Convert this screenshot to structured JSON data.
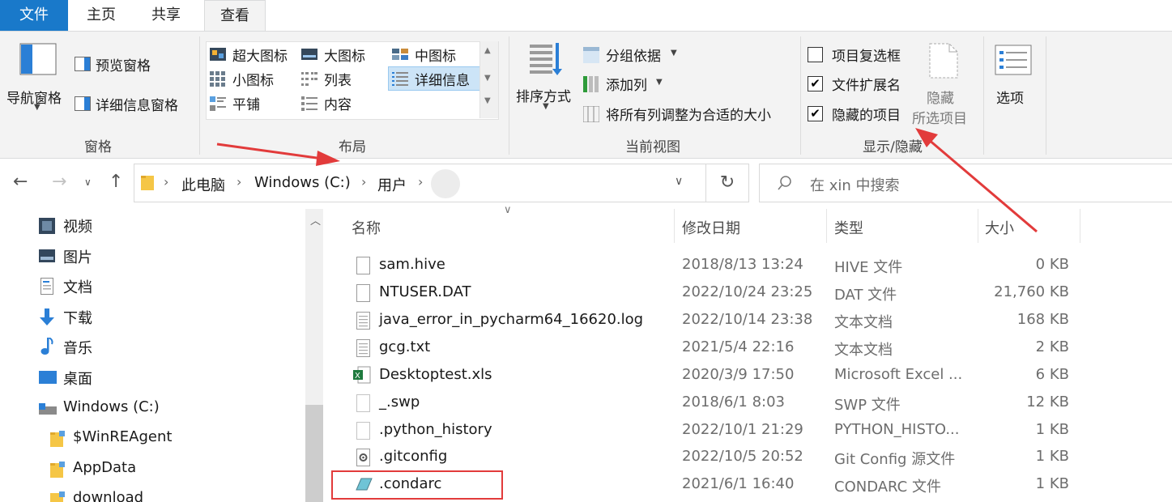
{
  "tabs": {
    "file": "文件",
    "home": "主页",
    "share": "共享",
    "view": "查看"
  },
  "ribbon": {
    "panes": {
      "nav_pane": "导航窗格",
      "preview_pane": "预览窗格",
      "details_pane": "详细信息窗格",
      "group": "窗格"
    },
    "layout": {
      "extra_large": "超大图标",
      "large": "大图标",
      "medium": "中图标",
      "small": "小图标",
      "list": "列表",
      "details": "详细信息",
      "tiles": "平铺",
      "content": "内容",
      "group": "布局"
    },
    "current_view": {
      "sort_by": "排序方式",
      "group_by": "分组依据",
      "add_column": "添加列",
      "fit_columns": "将所有列调整为合适的大小",
      "group": "当前视图"
    },
    "show_hide": {
      "item_checkboxes": "项目复选框",
      "file_extensions": "文件扩展名",
      "hidden_items": "隐藏的项目",
      "hide_selected_1": "隐藏",
      "hide_selected_2": "所选项目",
      "group": "显示/隐藏",
      "checkboxes": {
        "item_checkboxes": "",
        "file_extensions": "✔",
        "hidden_items": "✔"
      }
    },
    "options": "选项"
  },
  "address": {
    "breadcrumb": [
      "此电脑",
      "Windows (C:)",
      "用户"
    ],
    "search_placeholder": "在 xin 中搜索"
  },
  "nav_pane": {
    "items": [
      "视频",
      "图片",
      "文档",
      "下载",
      "音乐",
      "桌面",
      "Windows (C:)",
      "$WinREAgent",
      "AppData",
      "download"
    ]
  },
  "columns": {
    "name": "名称",
    "date": "修改日期",
    "type": "类型",
    "size": "大小"
  },
  "files": [
    {
      "name": "sam.hive",
      "date": "2018/8/13 13:24",
      "type": "HIVE 文件",
      "size": "0 KB",
      "icon": "file-icon"
    },
    {
      "name": "NTUSER.DAT",
      "date": "2022/10/24 23:25",
      "type": "DAT 文件",
      "size": "21,760 KB",
      "icon": "file-icon"
    },
    {
      "name": "java_error_in_pycharm64_16620.log",
      "date": "2022/10/14 23:38",
      "type": "文本文档",
      "size": "168 KB",
      "icon": "text-file-icon"
    },
    {
      "name": "gcg.txt",
      "date": "2021/5/4 22:16",
      "type": "文本文档",
      "size": "2 KB",
      "icon": "text-file-icon"
    },
    {
      "name": "Desktoptest.xls",
      "date": "2020/3/9 17:50",
      "type": "Microsoft Excel ...",
      "size": "6 KB",
      "icon": "excel-icon"
    },
    {
      "name": "_.swp",
      "date": "2018/6/1 8:03",
      "type": "SWP 文件",
      "size": "12 KB",
      "icon": "file-icon"
    },
    {
      "name": ".python_history",
      "date": "2022/10/1 21:29",
      "type": "PYTHON_HISTO...",
      "size": "1 KB",
      "icon": "file-icon"
    },
    {
      "name": ".gitconfig",
      "date": "2022/10/5 20:52",
      "type": "Git Config 源文件",
      "size": "1 KB",
      "icon": "gitconfig-icon"
    },
    {
      "name": ".condarc",
      "date": "2021/6/1 16:40",
      "type": "CONDARC 文件",
      "size": "1 KB",
      "icon": "condarc-icon"
    }
  ],
  "colors": {
    "accent": "#1979ca",
    "annotation": "#e23b3b"
  }
}
